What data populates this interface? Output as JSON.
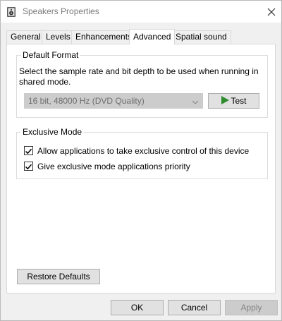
{
  "window": {
    "title": "Speakers Properties",
    "icons": {
      "app": "speaker-icon",
      "close": "close-icon"
    }
  },
  "tabs": [
    {
      "label": "General",
      "active": false
    },
    {
      "label": "Levels",
      "active": false
    },
    {
      "label": "Enhancements",
      "active": false
    },
    {
      "label": "Advanced",
      "active": true
    },
    {
      "label": "Spatial sound",
      "active": false
    }
  ],
  "default_format": {
    "legend": "Default Format",
    "description": "Select the sample rate and bit depth to be used when running in shared mode.",
    "format_value": "16 bit, 48000 Hz (DVD Quality)",
    "format_enabled": false,
    "test_label": "Test",
    "test_icon": "play-icon",
    "test_icon_color": "#2e8b2e"
  },
  "exclusive_mode": {
    "legend": "Exclusive Mode",
    "options": [
      {
        "label": "Allow applications to take exclusive control of this device",
        "checked": true
      },
      {
        "label": "Give exclusive mode applications priority",
        "checked": true
      }
    ]
  },
  "buttons": {
    "restore_defaults": "Restore Defaults",
    "ok": "OK",
    "cancel": "Cancel",
    "apply": "Apply",
    "apply_enabled": false
  }
}
